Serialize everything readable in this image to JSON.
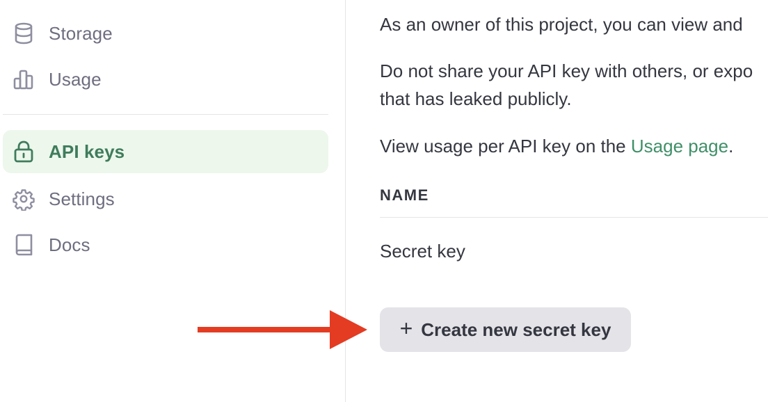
{
  "sidebar": {
    "items": [
      {
        "label": "Storage",
        "icon": "database-icon",
        "active": false
      },
      {
        "label": "Usage",
        "icon": "bar-chart-icon",
        "active": false
      },
      {
        "label": "API keys",
        "icon": "lock-icon",
        "active": true
      },
      {
        "label": "Settings",
        "icon": "gear-icon",
        "active": false
      },
      {
        "label": "Docs",
        "icon": "book-icon",
        "active": false
      }
    ]
  },
  "main": {
    "para1": "As an owner of this project, you can view and",
    "para2_line1": "Do not share your API key with others, or expo",
    "para2_line2": "that has leaked publicly.",
    "para3_prefix": "View usage per API key on the ",
    "para3_link": "Usage page",
    "para3_suffix": ".",
    "table": {
      "header": "NAME",
      "rows": [
        "Secret key"
      ]
    },
    "create_button": {
      "icon": "plus-icon",
      "label": "Create new secret key"
    }
  },
  "annotation": {
    "arrow_color": "#e33c23"
  },
  "colors": {
    "accent": "#3f8f68",
    "active_bg": "#edf7ec",
    "button_bg": "#e3e3e8"
  }
}
